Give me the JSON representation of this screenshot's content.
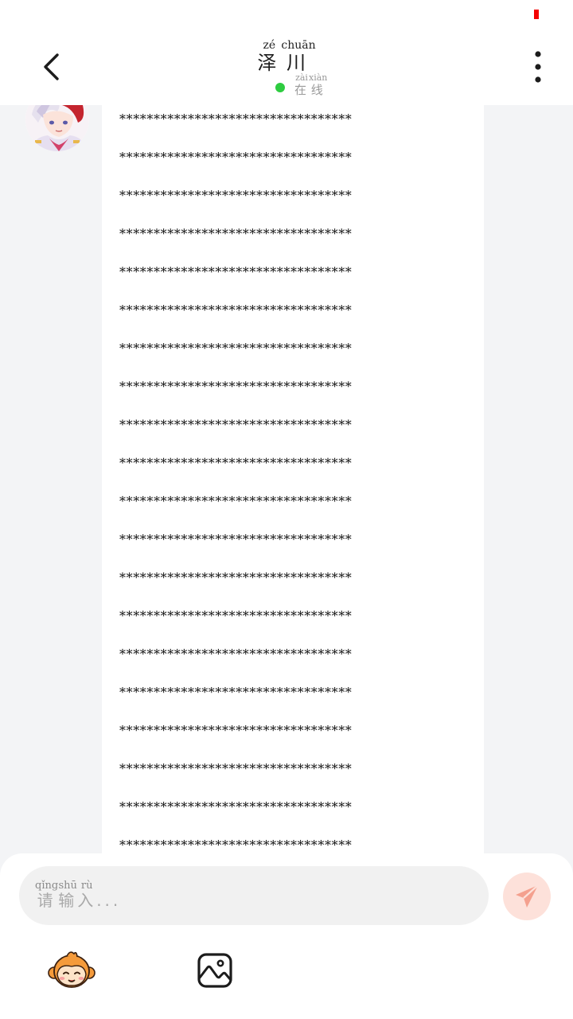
{
  "header": {
    "contact_name": "泽川",
    "contact_name_chars": [
      "泽",
      "川"
    ],
    "contact_name_pinyin": [
      "zé",
      "chuān"
    ],
    "status_label_chars": [
      "在",
      "线"
    ],
    "status_label_pinyin": [
      "zài",
      "xiàn"
    ],
    "status_color": "#2ecc40",
    "back_icon": "chevron-left-icon",
    "more_icon": "more-vertical-icon"
  },
  "message": {
    "lines": [
      "**********************************",
      "**********************************",
      "**********************************",
      "**********************************",
      "**********************************",
      "**********************************",
      "**********************************",
      "**********************************",
      "**********************************",
      "**********************************",
      "**********************************",
      "**********************************",
      "**********************************",
      "**********************************",
      "**********************************",
      "**********************************",
      "**********************************",
      "**********************************",
      "**********************************",
      "**********************************"
    ]
  },
  "input": {
    "placeholder": "请输入...",
    "placeholder_chars": [
      "请",
      "输",
      "入"
    ],
    "placeholder_pinyin": [
      "qǐng",
      "shū",
      "rù"
    ],
    "placeholder_suffix": "...",
    "send_icon": "send-icon",
    "send_color": "#f4a08e"
  },
  "toolbar": {
    "emoji_icon": "monkey-emoji-icon",
    "image_icon": "image-icon"
  },
  "colors": {
    "status_bar_indicator": "#f40000",
    "background": "#f3f4f6"
  }
}
